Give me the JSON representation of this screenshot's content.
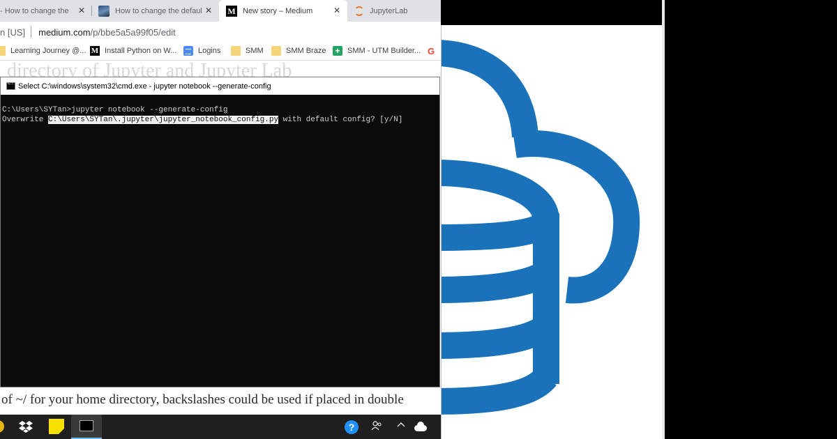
{
  "browser": {
    "tabs": [
      {
        "label": "- How to change the J",
        "icon": "page-icon",
        "active": false
      },
      {
        "label": "How to change the default",
        "icon": "image-thumbnail-icon",
        "active": false
      },
      {
        "label": "New story – Medium",
        "icon": "medium-icon",
        "active": true
      },
      {
        "label": "JupyterLab",
        "icon": "jupyter-icon",
        "active": false
      }
    ],
    "address": {
      "security_text": "n [US]",
      "url_domain": "medium.com",
      "url_path": "/p/bbe5a5a99f05/edit"
    },
    "bookmarks": [
      {
        "label": "Learning Journey @...",
        "icon": "folder-icon"
      },
      {
        "label": "Install Python on W...",
        "icon": "medium-icon"
      },
      {
        "label": "Logins",
        "icon": "google-docs-icon"
      },
      {
        "label": "SMM",
        "icon": "folder-icon"
      },
      {
        "label": "SMM Braze",
        "icon": "folder-icon"
      },
      {
        "label": "SMM - UTM Builder...",
        "icon": "google-sheets-icon"
      },
      {
        "label": "G",
        "icon": "google-icon"
      }
    ]
  },
  "article": {
    "heading_fragment": "directory of Jupyter and Jupyter Lab",
    "bottom_line": "of ~/ for your home directory, backslashes could be used if placed in double"
  },
  "cmd": {
    "title": "Select C:\\windows\\system32\\cmd.exe - jupyter  notebook --generate-config",
    "line1": "C:\\Users\\SYTan>jupyter notebook --generate-config",
    "line2_prefix": "Overwrite ",
    "line2_highlight": "C:\\Users\\SYTan\\.jupyter\\jupyter_notebook_config.py",
    "line2_suffix": " with default config? [y/N]"
  },
  "taskbar": {
    "icons": [
      "dropbox-icon",
      "sticky-notes-icon",
      "command-prompt-icon",
      "help-icon",
      "people-icon",
      "chevron-up-icon",
      "onedrive-icon"
    ]
  },
  "colors": {
    "logo_blue": "#1a73ba",
    "cmd_bg": "#0c0c0c",
    "taskbar_bg": "#1f1f1f"
  }
}
